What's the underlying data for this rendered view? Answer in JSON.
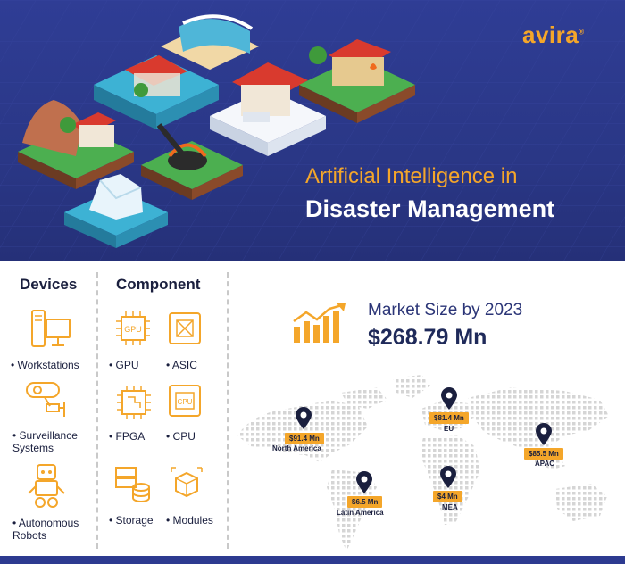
{
  "brand": {
    "logo_text": "avira",
    "accent": "#f4a62a",
    "navy": "#2d3a90"
  },
  "hero": {
    "title_line1": "Artificial Intelligence in",
    "title_line2": "Disaster Management"
  },
  "devices": {
    "title": "Devices",
    "items": [
      {
        "label": "• Workstations",
        "icon": "workstation-icon"
      },
      {
        "label": "• Surveillance\nSystems",
        "icon": "surveillance-camera-icon"
      },
      {
        "label": "• Autonomous\nRobots",
        "icon": "robot-icon"
      }
    ]
  },
  "component": {
    "title": "Component",
    "items": [
      {
        "label": "• GPU",
        "icon": "gpu-chip-icon"
      },
      {
        "label": "• ASIC",
        "icon": "asic-chip-icon"
      },
      {
        "label": "• FPGA",
        "icon": "fpga-chip-icon"
      },
      {
        "label": "• CPU",
        "icon": "cpu-chip-icon"
      },
      {
        "label": "• Storage",
        "icon": "storage-icon"
      },
      {
        "label": "• Modules",
        "icon": "modules-icon"
      }
    ],
    "gpu_chip_text": "GPU",
    "cpu_chip_text": "CPU"
  },
  "market": {
    "title": "Market Size by 2023",
    "value": "$268.79 Mn",
    "regions": [
      {
        "value": "$91.4 Mn",
        "name": "North America"
      },
      {
        "value": "$81.4 Mn",
        "name": "EU"
      },
      {
        "value": "$85.5 Mn",
        "name": "APAC"
      },
      {
        "value": "$6.5 Mn",
        "name": "Latin America"
      },
      {
        "value": "$4 Mn",
        "name": "MEA"
      }
    ]
  }
}
